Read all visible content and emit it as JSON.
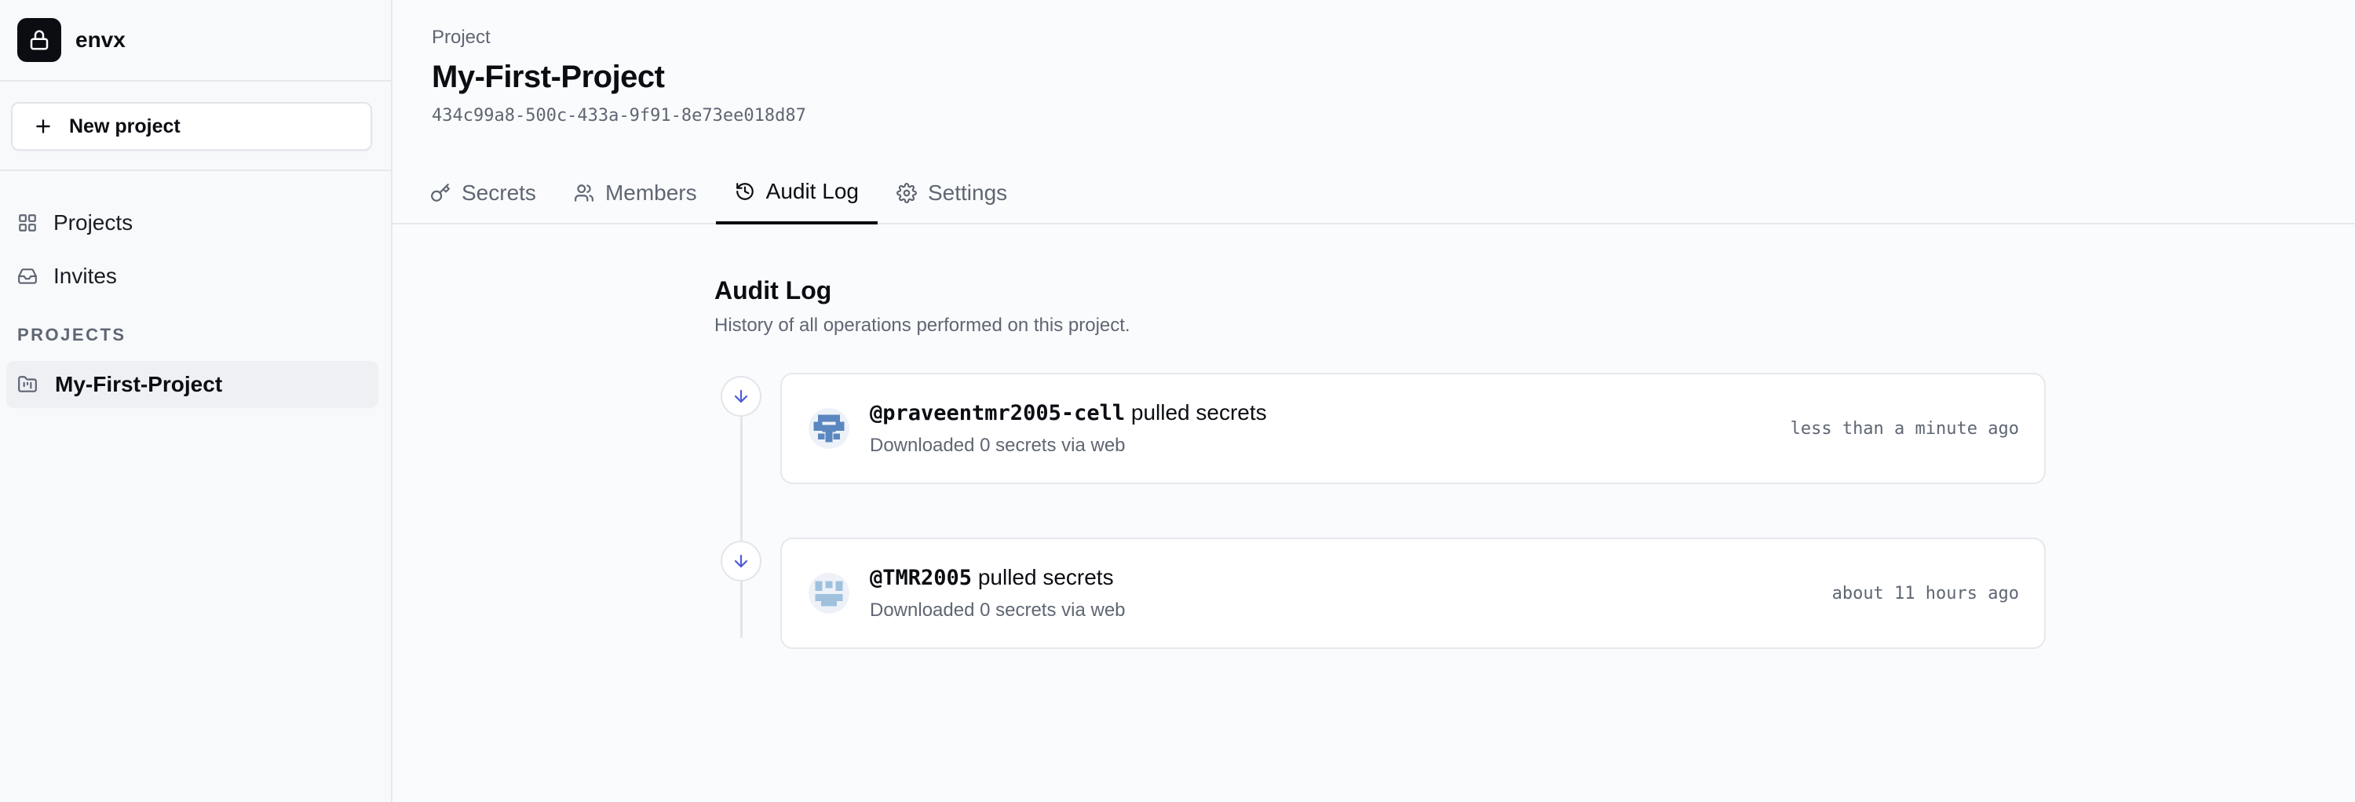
{
  "app": {
    "name": "envx"
  },
  "sidebar": {
    "new_project_label": "New project",
    "nav": [
      {
        "label": "Projects",
        "icon": "grid-icon"
      },
      {
        "label": "Invites",
        "icon": "inbox-icon"
      }
    ],
    "section_label": "PROJECTS",
    "projects": [
      {
        "label": "My-First-Project",
        "icon": "folder-kanban-icon"
      }
    ]
  },
  "header": {
    "breadcrumb": "Project",
    "title": "My-First-Project",
    "project_id": "434c99a8-500c-433a-9f91-8e73ee018d87"
  },
  "tabs": [
    {
      "label": "Secrets",
      "icon": "key-icon",
      "active": false
    },
    {
      "label": "Members",
      "icon": "users-icon",
      "active": false
    },
    {
      "label": "Audit Log",
      "icon": "history-icon",
      "active": true
    },
    {
      "label": "Settings",
      "icon": "gear-icon",
      "active": false
    }
  ],
  "audit": {
    "title": "Audit Log",
    "subtitle": "History of all operations performed on this project.",
    "entries": [
      {
        "user": "@praveentmr2005-cell",
        "action": " pulled secrets",
        "detail": "Downloaded 0 secrets via web",
        "time": "less than a minute ago",
        "icon": "arrow-down-icon"
      },
      {
        "user": "@TMR2005",
        "action": " pulled secrets",
        "detail": "Downloaded 0 secrets via web",
        "time": "about 11 hours ago",
        "icon": "arrow-down-icon"
      }
    ]
  },
  "colors": {
    "accent": "#0b0d12",
    "muted_text": "#5f6673",
    "timeline_arrow": "#4f5bd5",
    "avatar_blue": "#5b87c0",
    "avatar_light_blue": "#9fc1de"
  }
}
